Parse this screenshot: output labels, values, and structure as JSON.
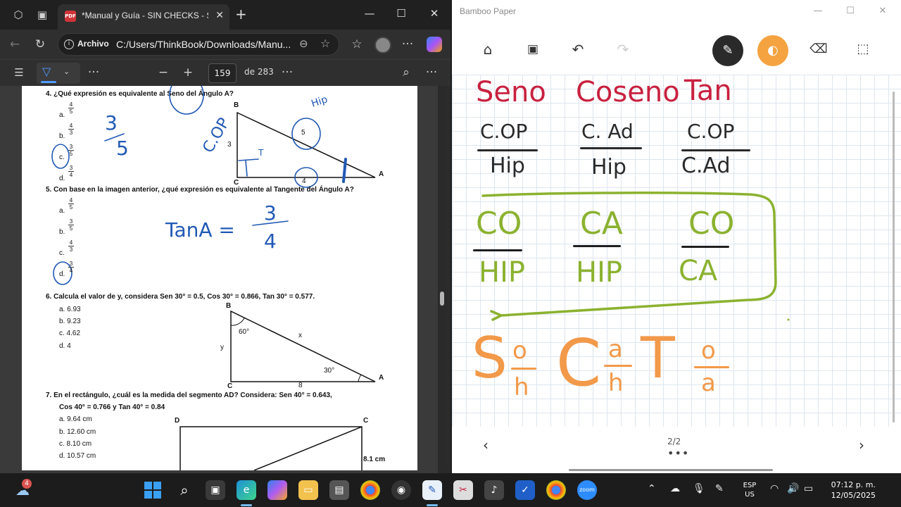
{
  "edge": {
    "tab_title": "*Manual y Guía - SIN CHECKS - SI",
    "omnibox_label": "Archivo",
    "url": "C:/Users/ThinkBook/Downloads/Manu...",
    "page_current": "159",
    "page_total": "de 283"
  },
  "pdf": {
    "q4": "4.   ¿Qué expresión es equivalente al Seno del Ángulo A?",
    "q5": "5.   Con base en la imagen anterior, ¿qué expresión es equivalente al Tangente del Ángulo A?",
    "q6": "6.   Calcula el valor de y, considera Sen 30° = 0.5, Cos 30° = 0.866, Tan 30° = 0.577.",
    "q7a": "7.   En el rectángulo, ¿cuál es la medida del segmento AD? Considera: Sen 40° = 0.643,",
    "q7b": "Cos 40° = 0.766 y Tan 40° = 0.84",
    "q4_options": [
      {
        "letter": "a.",
        "num": "4",
        "den": "5"
      },
      {
        "letter": "b.",
        "num": "4",
        "den": "3"
      },
      {
        "letter": "c.",
        "num": "3",
        "den": "5"
      },
      {
        "letter": "d.",
        "num": "3",
        "den": "4"
      }
    ],
    "q5_options": [
      {
        "letter": "a.",
        "num": "4",
        "den": "5"
      },
      {
        "letter": "b.",
        "num": "3",
        "den": "5"
      },
      {
        "letter": "c.",
        "num": "4",
        "den": "3"
      },
      {
        "letter": "d.",
        "num": "3",
        "den": "4"
      }
    ],
    "q6_options": [
      "a.  6.93",
      "b.  9.23",
      "c.  4.62",
      "d.  4"
    ],
    "q7_options": [
      "a.  9.64 cm",
      "b.  12.60 cm",
      "c.  8.10 cm",
      "d.  10.57 cm"
    ],
    "tri1": {
      "B": "B",
      "C": "C",
      "A": "A",
      "side_bc": "3",
      "side_ca": "4",
      "side_ab": "5"
    },
    "tri2": {
      "B": "B",
      "C": "C",
      "A": "A",
      "angle_b": "60°",
      "angle_a": "30°",
      "x": "x",
      "y": "y",
      "side_ca": "8"
    },
    "rect": {
      "D": "D",
      "C": "C",
      "side": "8.1 cm"
    },
    "ink": {
      "frac_num": "3",
      "frac_den": "5",
      "cop": "C.OP",
      "hip": "Hip",
      "tiny_t": "T",
      "tan_eq": "TanA =",
      "tan_num": "3",
      "tan_den": "4"
    }
  },
  "bamboo": {
    "title": "Bamboo Paper",
    "page_indicator": "2/2",
    "headers": [
      "Seno",
      "Coseno",
      "Tan"
    ],
    "fractions": [
      {
        "num": "C.OP",
        "den": "Hip"
      },
      {
        "num": "C. Ad",
        "den": "Hip"
      },
      {
        "num": "C.OP",
        "den": "C.Ad"
      }
    ],
    "green": [
      {
        "num": "CO",
        "den": "HIP"
      },
      {
        "num": "CA",
        "den": "HIP"
      },
      {
        "num": "CO",
        "den": "CA"
      }
    ],
    "mnemonic": [
      {
        "letter": "S",
        "num": "o",
        "den": "h"
      },
      {
        "letter": "C",
        "num": "a",
        "den": "h"
      },
      {
        "letter": "T",
        "num": "o",
        "den": "a"
      }
    ],
    "colors": {
      "red": "#c8213f",
      "black": "#2a2a2a",
      "green": "#8bb230",
      "orange": "#f2994a"
    }
  },
  "taskbar": {
    "weather_badge": "4",
    "lang_line1": "ESP",
    "lang_line2": "US",
    "time": "07:12 p. m.",
    "date": "12/05/2025",
    "zoom_label": "zoom"
  }
}
